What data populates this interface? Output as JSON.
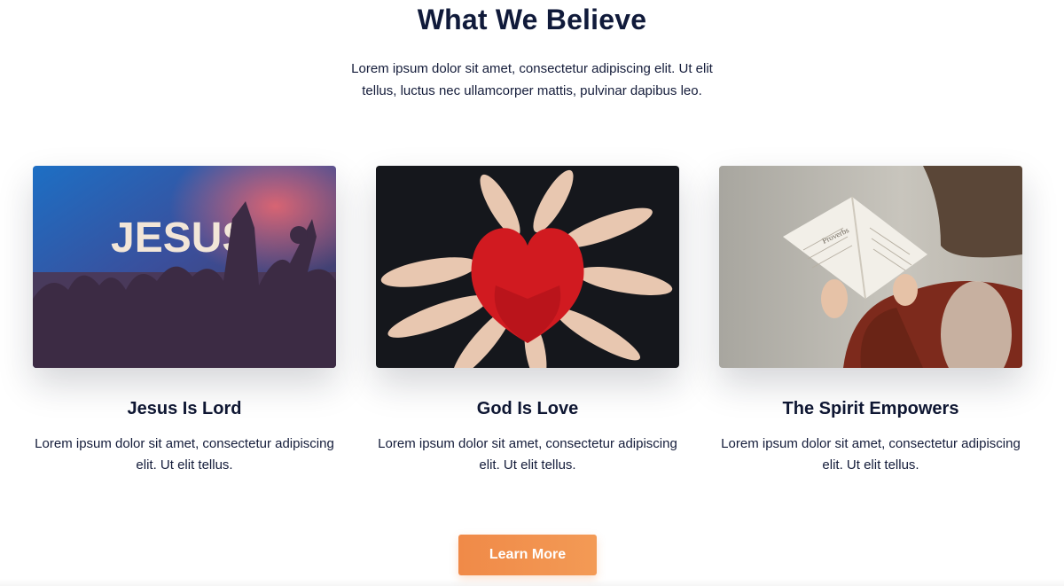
{
  "section": {
    "title": "What We Believe",
    "intro": "Lorem ipsum dolor sit amet, consectetur adipiscing elit. Ut elit tellus, luctus nec ullamcorper mattis, pulvinar dapibus leo."
  },
  "cards": [
    {
      "title": "Jesus Is Lord",
      "text": "Lorem ipsum dolor sit amet, consectetur adipiscing elit. Ut elit tellus.",
      "image_text": "JESUS"
    },
    {
      "title": "God Is Love",
      "text": "Lorem ipsum dolor sit amet, consectetur adipiscing elit. Ut elit tellus."
    },
    {
      "title": "The Spirit Empowers",
      "text": "Lorem ipsum dolor sit amet, consectetur adipiscing elit. Ut elit tellus.",
      "image_text": "Proverbs"
    }
  ],
  "cta": {
    "label": "Learn More",
    "color": "#f08a48"
  }
}
